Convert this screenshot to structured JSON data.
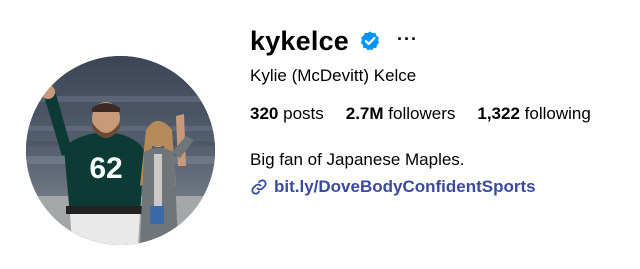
{
  "profile": {
    "username": "kykelce",
    "full_name": "Kylie (McDevitt) Kelce",
    "verified": true,
    "more_icon": "more-dots-icon",
    "stats": {
      "posts_value": "320",
      "posts_label": "posts",
      "followers_value": "2.7M",
      "followers_label": "followers",
      "following_value": "1,322",
      "following_label": "following"
    },
    "bio": "Big fan of Japanese Maples.",
    "link": {
      "icon": "link-icon",
      "text": "bit.ly/DoveBodyConfidentSports"
    },
    "avatar": {
      "jersey_number": "62"
    }
  },
  "colors": {
    "verified_blue": "#0095f6",
    "link_color": "#3b4a9e",
    "jersey_green": "#0c3b36"
  }
}
